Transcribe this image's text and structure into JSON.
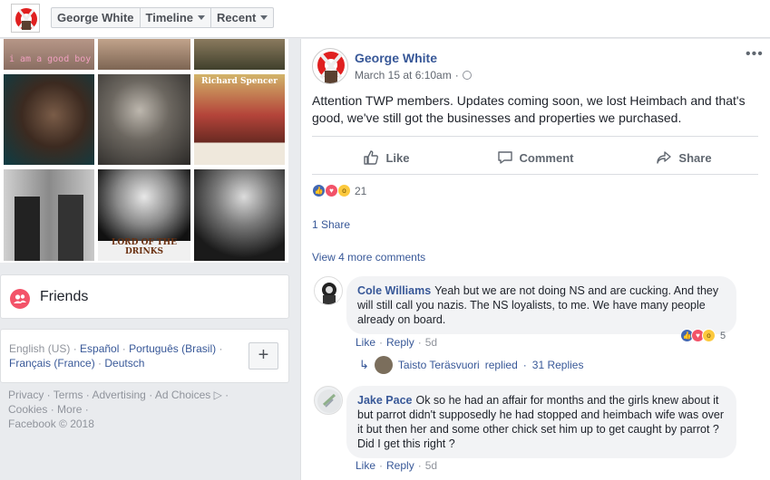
{
  "topbar": {
    "name_button": "George White",
    "timeline_button": "Timeline",
    "recent_button": "Recent"
  },
  "photos": {
    "tile1_text": "i am a good boy",
    "tile6_text": "Richard Spencer",
    "tile8_caption": "LORD OF THE DRINKS"
  },
  "sidebar": {
    "friends_label": "Friends",
    "languages": [
      "English (US)",
      "Español",
      "Português (Brasil)",
      "Français (France)",
      "Deutsch"
    ],
    "add_language": "+",
    "footer_links": [
      "Privacy",
      "Terms",
      "Advertising",
      "Ad Choices",
      "Cookies",
      "More"
    ],
    "copyright": "Facebook © 2018"
  },
  "post": {
    "author": "George White",
    "date": "March 15 at 6:10am",
    "more_options": "•••",
    "text": "Attention TWP members. Updates coming soon, we lost Heimbach and that's good, we've still got the businesses and properties we purchased.",
    "actions": {
      "like": "Like",
      "comment": "Comment",
      "share": "Share"
    },
    "reaction_count": "21",
    "shares_label": "1 Share",
    "more_comments_label": "View 4 more comments"
  },
  "comments": [
    {
      "author": "Cole Williams",
      "text": "Yeah but we are not doing NS and are cucking. And they will still call you nazis. The NS loyalists, to me. We have many people already on board.",
      "like": "Like",
      "reply": "Reply",
      "time": "5d",
      "reaction_count": "5",
      "reply_preview": {
        "author": "Taisto Teräsvuori",
        "action": "replied",
        "count": "31 Replies"
      }
    },
    {
      "author": "Jake Pace",
      "text": "Ok so he had an affair for months and the girls knew about it but parrot didn't supposedly he had stopped and heimbach wife was over it but then her and some other chick set him up to get caught by parrot ? Did I get this right ?",
      "like": "Like",
      "reply": "Reply",
      "time": "5d"
    }
  ],
  "colors": {
    "link": "#385898",
    "background": "#e9ebee",
    "like_blue": "#4267b2",
    "love_red": "#f25268",
    "wow_yellow": "#fcc93d"
  }
}
